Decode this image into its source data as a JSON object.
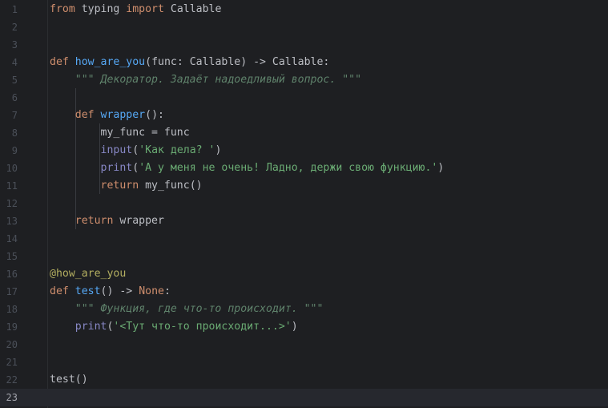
{
  "editor": {
    "current_line": 23,
    "lines": [
      {
        "n": "1",
        "tokens": [
          {
            "c": "kw",
            "t": "from"
          },
          {
            "c": "tx",
            "t": " typing "
          },
          {
            "c": "kw",
            "t": "import"
          },
          {
            "c": "tx",
            "t": " Callable"
          }
        ]
      },
      {
        "n": "2",
        "tokens": []
      },
      {
        "n": "3",
        "tokens": []
      },
      {
        "n": "4",
        "tokens": [
          {
            "c": "kw",
            "t": "def"
          },
          {
            "c": "tx",
            "t": " "
          },
          {
            "c": "fn",
            "t": "how_are_you"
          },
          {
            "c": "tx",
            "t": "(func: Callable) -> Callable:"
          }
        ]
      },
      {
        "n": "5",
        "tokens": [
          {
            "c": "tx",
            "t": "    "
          },
          {
            "c": "doc",
            "t": "\"\"\" Декоратор. Задаёт надоедливый вопрос. \"\"\""
          }
        ]
      },
      {
        "n": "6",
        "tokens": []
      },
      {
        "n": "7",
        "tokens": [
          {
            "c": "tx",
            "t": "    "
          },
          {
            "c": "kw",
            "t": "def"
          },
          {
            "c": "tx",
            "t": " "
          },
          {
            "c": "fn",
            "t": "wrapper"
          },
          {
            "c": "tx",
            "t": "():"
          }
        ]
      },
      {
        "n": "8",
        "tokens": [
          {
            "c": "tx",
            "t": "        my_func = func"
          }
        ]
      },
      {
        "n": "9",
        "tokens": [
          {
            "c": "tx",
            "t": "        "
          },
          {
            "c": "bi",
            "t": "input"
          },
          {
            "c": "tx",
            "t": "("
          },
          {
            "c": "st",
            "t": "'Как дела? '"
          },
          {
            "c": "tx",
            "t": ")"
          }
        ]
      },
      {
        "n": "10",
        "tokens": [
          {
            "c": "tx",
            "t": "        "
          },
          {
            "c": "bi",
            "t": "print"
          },
          {
            "c": "tx",
            "t": "("
          },
          {
            "c": "st",
            "t": "'А у меня не очень! Ладно, держи свою функцию.'"
          },
          {
            "c": "tx",
            "t": ")"
          }
        ]
      },
      {
        "n": "11",
        "tokens": [
          {
            "c": "tx",
            "t": "        "
          },
          {
            "c": "kw",
            "t": "return"
          },
          {
            "c": "tx",
            "t": " my_func()"
          }
        ]
      },
      {
        "n": "12",
        "tokens": []
      },
      {
        "n": "13",
        "tokens": [
          {
            "c": "tx",
            "t": "    "
          },
          {
            "c": "kw",
            "t": "return"
          },
          {
            "c": "tx",
            "t": " wrapper"
          }
        ]
      },
      {
        "n": "14",
        "tokens": []
      },
      {
        "n": "15",
        "tokens": []
      },
      {
        "n": "16",
        "tokens": [
          {
            "c": "dec",
            "t": "@how_are_you"
          }
        ]
      },
      {
        "n": "17",
        "tokens": [
          {
            "c": "kw",
            "t": "def"
          },
          {
            "c": "tx",
            "t": " "
          },
          {
            "c": "fn",
            "t": "test"
          },
          {
            "c": "tx",
            "t": "() -> "
          },
          {
            "c": "kw",
            "t": "None"
          },
          {
            "c": "tx",
            "t": ":"
          }
        ]
      },
      {
        "n": "18",
        "tokens": [
          {
            "c": "tx",
            "t": "    "
          },
          {
            "c": "doc",
            "t": "\"\"\" Функция, где что-то происходит. \"\"\""
          }
        ]
      },
      {
        "n": "19",
        "tokens": [
          {
            "c": "tx",
            "t": "    "
          },
          {
            "c": "bi",
            "t": "print"
          },
          {
            "c": "tx",
            "t": "("
          },
          {
            "c": "st",
            "t": "'<Тут что-то происходит...>'"
          },
          {
            "c": "tx",
            "t": ")"
          }
        ]
      },
      {
        "n": "20",
        "tokens": []
      },
      {
        "n": "21",
        "tokens": []
      },
      {
        "n": "22",
        "tokens": [
          {
            "c": "tx",
            "t": "test()"
          }
        ]
      },
      {
        "n": "23",
        "tokens": []
      }
    ]
  }
}
